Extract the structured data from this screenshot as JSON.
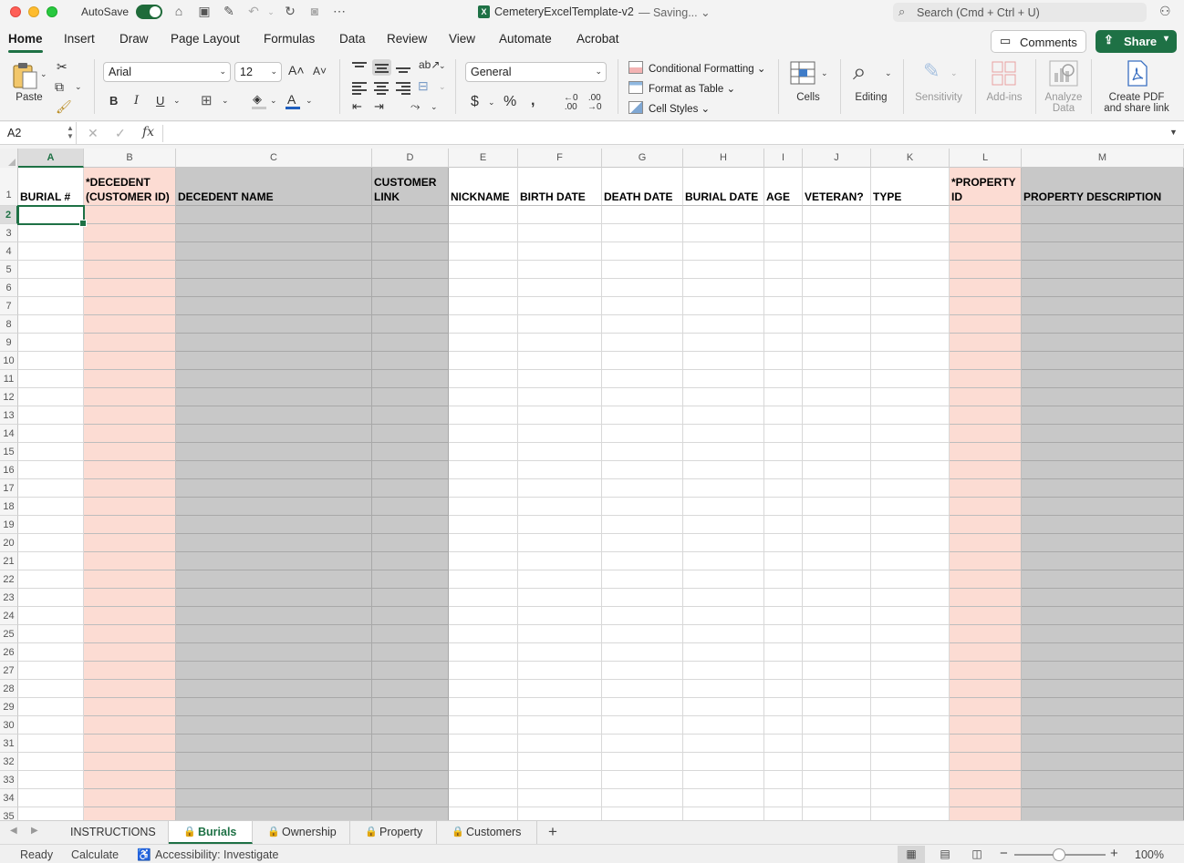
{
  "titlebar": {
    "autosave_label": "AutoSave",
    "doc_title": "CemeteryExcelTemplate-v2",
    "doc_status": "— Saving... ⌄",
    "search_placeholder": "Search (Cmd + Ctrl + U)"
  },
  "tabs": [
    "Home",
    "Insert",
    "Draw",
    "Page Layout",
    "Formulas",
    "Data",
    "Review",
    "View",
    "Automate",
    "Acrobat"
  ],
  "comments_label": "Comments",
  "share_label": "Share",
  "ribbon": {
    "paste_label": "Paste",
    "font_name": "Arial",
    "font_size": "12",
    "bold": "B",
    "italic": "I",
    "underline": "U",
    "number_format": "General",
    "conditional_formatting": "Conditional Formatting",
    "format_as_table": "Format as Table",
    "cell_styles": "Cell Styles",
    "cells_label": "Cells",
    "editing_label": "Editing",
    "sensitivity_label": "Sensitivity",
    "addins_label": "Add-ins",
    "analyze_label_1": "Analyze",
    "analyze_label_2": "Data",
    "create_pdf_1": "Create PDF",
    "create_pdf_2": "and share link"
  },
  "formula_bar": {
    "name_box": "A2",
    "formula": ""
  },
  "columns": [
    {
      "letter": "A",
      "header": "BURIAL #",
      "fill": "white"
    },
    {
      "letter": "B",
      "header": "*DECEDENT (CUSTOMER ID)",
      "fill": "pink"
    },
    {
      "letter": "C",
      "header": "DECEDENT NAME",
      "fill": "gray"
    },
    {
      "letter": "D",
      "header": "CUSTOMER LINK",
      "fill": "gray"
    },
    {
      "letter": "E",
      "header": "NICKNAME",
      "fill": "white"
    },
    {
      "letter": "F",
      "header": "BIRTH DATE",
      "fill": "white"
    },
    {
      "letter": "G",
      "header": "DEATH DATE",
      "fill": "white"
    },
    {
      "letter": "H",
      "header": "BURIAL DATE",
      "fill": "white"
    },
    {
      "letter": "I",
      "header": "AGE",
      "fill": "white"
    },
    {
      "letter": "J",
      "header": "VETERAN?",
      "fill": "white"
    },
    {
      "letter": "K",
      "header": "TYPE",
      "fill": "white"
    },
    {
      "letter": "L",
      "header": "*PROPERTY ID",
      "fill": "pink"
    },
    {
      "letter": "M",
      "header": "PROPERTY DESCRIPTION",
      "fill": "gray"
    }
  ],
  "row_count": 35,
  "active_cell": "A2",
  "colors": {
    "accent": "#1e7145",
    "pink_fill": "#fcdcd3",
    "gray_fill": "#c8c8c8"
  },
  "sheets": [
    {
      "name": "INSTRUCTIONS",
      "locked": false,
      "active": false
    },
    {
      "name": "Burials",
      "locked": true,
      "active": true
    },
    {
      "name": "Ownership",
      "locked": true,
      "active": false
    },
    {
      "name": "Property",
      "locked": true,
      "active": false
    },
    {
      "name": "Customers",
      "locked": true,
      "active": false
    }
  ],
  "status": {
    "ready": "Ready",
    "calculate": "Calculate",
    "accessibility": "Accessibility: Investigate",
    "zoom": "100%"
  }
}
